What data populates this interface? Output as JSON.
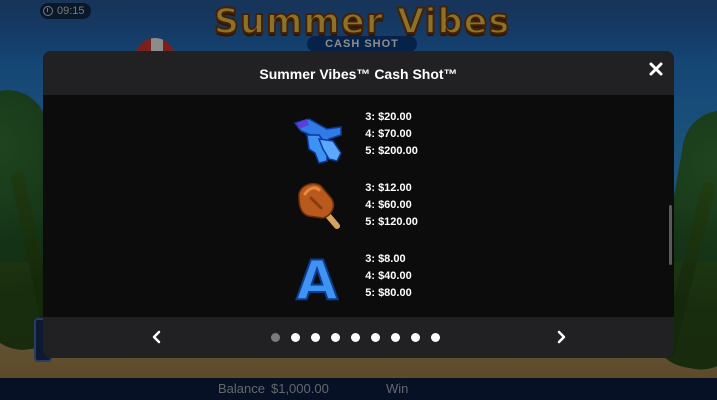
{
  "game": {
    "logo_main": "Summer Vibes",
    "logo_sub": "CASH SHOT",
    "clock": "09:15",
    "balance_label": "Balance",
    "balance_value": "$1,000.00",
    "win_label": "Win"
  },
  "modal": {
    "title": "Summer Vibes™ Cash Shot™",
    "paytable": [
      {
        "symbol": "flippers-icon",
        "pays": [
          {
            "count": "3:",
            "value": "$20.00"
          },
          {
            "count": "4:",
            "value": "$70.00"
          },
          {
            "count": "5:",
            "value": "$200.00"
          }
        ]
      },
      {
        "symbol": "popsicle-icon",
        "pays": [
          {
            "count": "3:",
            "value": "$12.00"
          },
          {
            "count": "4:",
            "value": "$60.00"
          },
          {
            "count": "5:",
            "value": "$120.00"
          }
        ]
      },
      {
        "symbol": "letter-a-icon",
        "symbol_text": "A",
        "pays": [
          {
            "count": "3:",
            "value": "$8.00"
          },
          {
            "count": "4:",
            "value": "$40.00"
          },
          {
            "count": "5:",
            "value": "$80.00"
          }
        ]
      }
    ],
    "pagination": {
      "total_pages": 9,
      "current_page": 1
    }
  },
  "colors": {
    "modal_bg": "#0c0c0d",
    "modal_header_bg": "#212123",
    "symbol_blue": "#2f7be8",
    "popsicle_brown": "#b85a1e"
  }
}
